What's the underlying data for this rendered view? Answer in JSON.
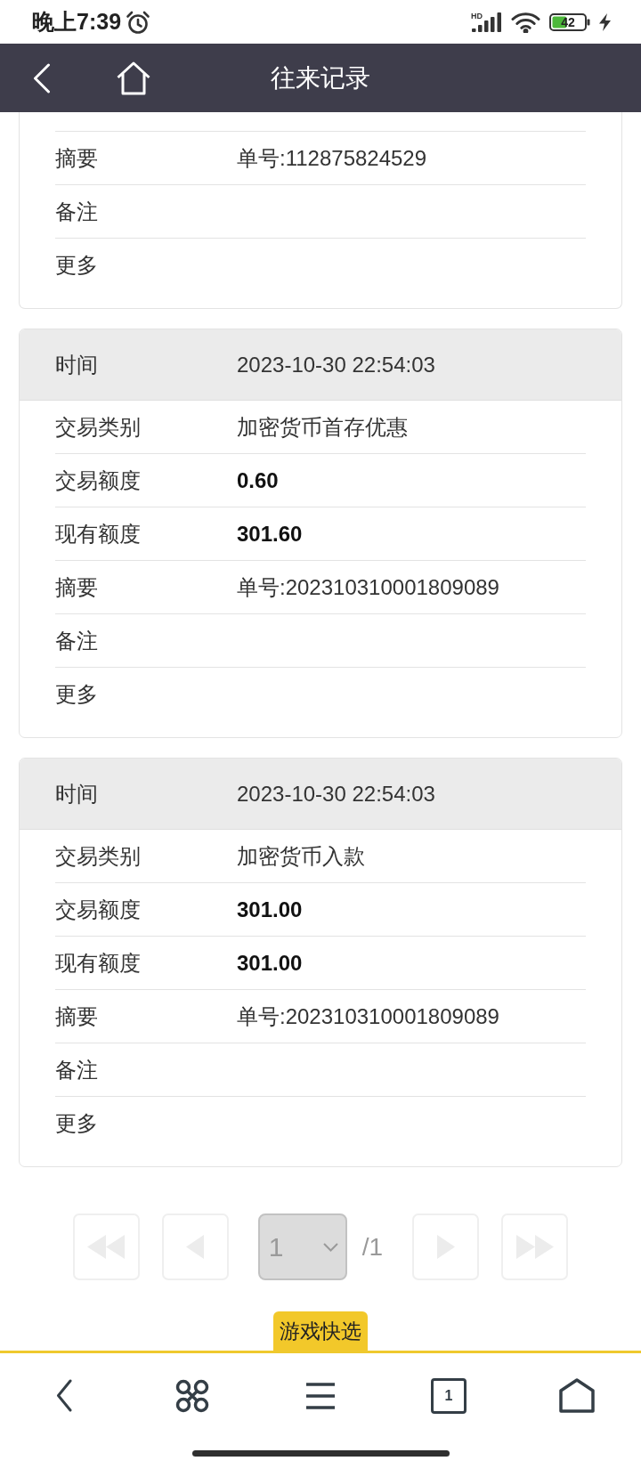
{
  "status_bar": {
    "time": "晚上7:39",
    "alarm_set": true,
    "network_label": "HD",
    "battery": "42",
    "charging": true
  },
  "header": {
    "buttons": [
      {
        "kind": "back"
      },
      {
        "kind": "home"
      }
    ],
    "title": "往来记录"
  },
  "records": [
    {
      "rows": [
        {
          "kind": "text",
          "label": "摘要",
          "value": "单号:112875824529"
        },
        {
          "kind": "text",
          "label": "备注"
        },
        {
          "kind": "text",
          "label": "更多"
        }
      ]
    },
    {
      "header": {
        "label": "时间",
        "value": "2023-10-30 22:54:03"
      },
      "rows": [
        {
          "kind": "text",
          "label": "交易类别",
          "value": "加密货币首存优惠"
        },
        {
          "kind": "amount",
          "label": "交易额度",
          "value": "0.60"
        },
        {
          "kind": "amount",
          "label": "现有额度",
          "value": "301.60"
        },
        {
          "kind": "text",
          "label": "摘要",
          "value": "单号:202310310001809089"
        },
        {
          "kind": "text",
          "label": "备注"
        },
        {
          "kind": "text",
          "label": "更多"
        }
      ]
    },
    {
      "header": {
        "label": "时间",
        "value": "2023-10-30 22:54:03"
      },
      "rows": [
        {
          "kind": "text",
          "label": "交易类别",
          "value": "加密货币入款"
        },
        {
          "kind": "amount",
          "label": "交易额度",
          "value": "301.00"
        },
        {
          "kind": "amount",
          "label": "现有额度",
          "value": "301.00"
        },
        {
          "kind": "text",
          "label": "摘要",
          "value": "单号:202310310001809089"
        },
        {
          "kind": "text",
          "label": "备注"
        },
        {
          "kind": "text",
          "label": "更多"
        }
      ]
    }
  ],
  "pagination": {
    "controls": [
      {
        "kind": "first",
        "disabled": true
      },
      {
        "kind": "previous",
        "disabled": true
      },
      {
        "kind": "page_select",
        "value": "1",
        "disabled": true
      },
      {
        "kind": "total",
        "text": "/1"
      },
      {
        "kind": "next",
        "disabled": true
      },
      {
        "kind": "last",
        "disabled": true
      }
    ]
  },
  "quick_tab": {
    "label": "游戏快选"
  },
  "bottom_nav": [
    {
      "kind": "back"
    },
    {
      "kind": "shortcuts"
    },
    {
      "kind": "menu"
    },
    {
      "kind": "tabs",
      "count": "1"
    },
    {
      "kind": "home"
    }
  ]
}
